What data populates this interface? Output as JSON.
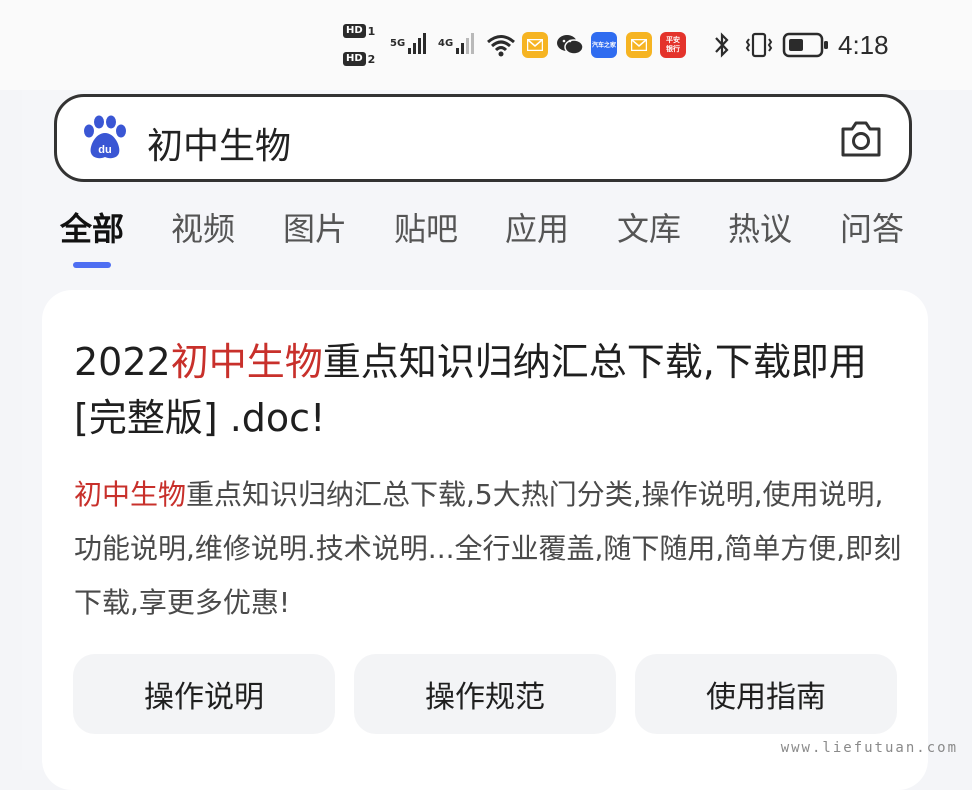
{
  "status_bar": {
    "hd1": "HD",
    "hd1_num": "1",
    "hd2": "HD",
    "hd2_num": "2",
    "net1": "5G",
    "net2": "4G",
    "time": "4:18",
    "icons": [
      "signal-5g-icon",
      "signal-4g-icon",
      "wifi-icon",
      "mail-app-icon",
      "wechat-icon",
      "blue-app-icon",
      "mail-app-icon",
      "red-app-icon",
      "bluetooth-icon",
      "vibrate-icon",
      "battery-icon"
    ],
    "app_text_blue": "汽车之家",
    "app_text_red": "平安银行"
  },
  "search": {
    "query": "初中生物",
    "logo": "baidu-paw-icon",
    "camera": "camera-icon"
  },
  "tabs": [
    {
      "label": "全部",
      "active": true
    },
    {
      "label": "视频"
    },
    {
      "label": "图片"
    },
    {
      "label": "贴吧"
    },
    {
      "label": "应用"
    },
    {
      "label": "文库"
    },
    {
      "label": "热议"
    },
    {
      "label": "问答"
    }
  ],
  "result": {
    "title_pre": "2022",
    "title_hl": "初中生物",
    "title_post": "重点知识归纳汇总下载,下载即用 [完整版] .doc!",
    "desc_hl": "初中生物",
    "desc_post": "重点知识归纳汇总下载,5大热门分类,操作说明,使用说明,功能说明,维修说明.技术说明...全行业覆盖,随下随用,简单方便,即刻下载,享更多优惠!",
    "chips": [
      "操作说明",
      "操作规范",
      "使用指南"
    ]
  },
  "colors": {
    "highlight": "#c8302b",
    "accent": "#4e6ef2"
  },
  "watermark": "www.liefutuan.com"
}
